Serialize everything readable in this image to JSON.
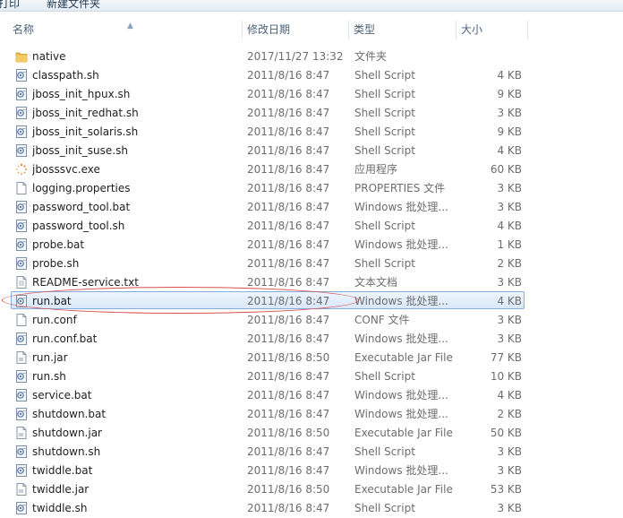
{
  "toolbar": {
    "print_label": "打印",
    "new_folder_label": "新建文件夹"
  },
  "columns": {
    "name": "名称",
    "date": "修改日期",
    "type": "类型",
    "size": "大小"
  },
  "files": [
    {
      "name": "native",
      "date": "2017/11/27 13:32",
      "type": "文件夹",
      "size": "",
      "icon": "folder-icon"
    },
    {
      "name": "classpath.sh",
      "date": "2011/8/16 8:47",
      "type": "Shell Script",
      "size": "4 KB",
      "icon": "script-file-icon"
    },
    {
      "name": "jboss_init_hpux.sh",
      "date": "2011/8/16 8:47",
      "type": "Shell Script",
      "size": "9 KB",
      "icon": "script-file-icon"
    },
    {
      "name": "jboss_init_redhat.sh",
      "date": "2011/8/16 8:47",
      "type": "Shell Script",
      "size": "3 KB",
      "icon": "script-file-icon"
    },
    {
      "name": "jboss_init_solaris.sh",
      "date": "2011/8/16 8:47",
      "type": "Shell Script",
      "size": "9 KB",
      "icon": "script-file-icon"
    },
    {
      "name": "jboss_init_suse.sh",
      "date": "2011/8/16 8:47",
      "type": "Shell Script",
      "size": "4 KB",
      "icon": "script-file-icon"
    },
    {
      "name": "jbosssvc.exe",
      "date": "2011/8/16 8:47",
      "type": "应用程序",
      "size": "60 KB",
      "icon": "exe-icon"
    },
    {
      "name": "logging.properties",
      "date": "2011/8/16 8:47",
      "type": "PROPERTIES 文件",
      "size": "3 KB",
      "icon": "blank-file-icon"
    },
    {
      "name": "password_tool.bat",
      "date": "2011/8/16 8:47",
      "type": "Windows 批处理...",
      "size": "3 KB",
      "icon": "script-file-icon"
    },
    {
      "name": "password_tool.sh",
      "date": "2011/8/16 8:47",
      "type": "Shell Script",
      "size": "4 KB",
      "icon": "script-file-icon"
    },
    {
      "name": "probe.bat",
      "date": "2011/8/16 8:47",
      "type": "Windows 批处理...",
      "size": "1 KB",
      "icon": "script-file-icon"
    },
    {
      "name": "probe.sh",
      "date": "2011/8/16 8:47",
      "type": "Shell Script",
      "size": "2 KB",
      "icon": "script-file-icon"
    },
    {
      "name": "README-service.txt",
      "date": "2011/8/16 8:47",
      "type": "文本文档",
      "size": "3 KB",
      "icon": "text-file-icon"
    },
    {
      "name": "run.bat",
      "date": "2011/8/16 8:47",
      "type": "Windows 批处理...",
      "size": "4 KB",
      "icon": "script-file-icon",
      "selected": true
    },
    {
      "name": "run.conf",
      "date": "2011/8/16 8:47",
      "type": "CONF 文件",
      "size": "3 KB",
      "icon": "blank-file-icon"
    },
    {
      "name": "run.conf.bat",
      "date": "2011/8/16 8:47",
      "type": "Windows 批处理...",
      "size": "3 KB",
      "icon": "script-file-icon"
    },
    {
      "name": "run.jar",
      "date": "2011/8/16 8:50",
      "type": "Executable Jar File",
      "size": "77 KB",
      "icon": "jar-file-icon"
    },
    {
      "name": "run.sh",
      "date": "2011/8/16 8:47",
      "type": "Shell Script",
      "size": "10 KB",
      "icon": "script-file-icon"
    },
    {
      "name": "service.bat",
      "date": "2011/8/16 8:47",
      "type": "Windows 批处理...",
      "size": "4 KB",
      "icon": "script-file-icon"
    },
    {
      "name": "shutdown.bat",
      "date": "2011/8/16 8:47",
      "type": "Windows 批处理...",
      "size": "2 KB",
      "icon": "script-file-icon"
    },
    {
      "name": "shutdown.jar",
      "date": "2011/8/16 8:50",
      "type": "Executable Jar File",
      "size": "50 KB",
      "icon": "jar-file-icon"
    },
    {
      "name": "shutdown.sh",
      "date": "2011/8/16 8:47",
      "type": "Shell Script",
      "size": "3 KB",
      "icon": "script-file-icon"
    },
    {
      "name": "twiddle.bat",
      "date": "2011/8/16 8:47",
      "type": "Windows 批处理...",
      "size": "3 KB",
      "icon": "script-file-icon"
    },
    {
      "name": "twiddle.jar",
      "date": "2011/8/16 8:50",
      "type": "Executable Jar File",
      "size": "53 KB",
      "icon": "jar-file-icon"
    },
    {
      "name": "twiddle.sh",
      "date": "2011/8/16 8:47",
      "type": "Shell Script",
      "size": "3 KB",
      "icon": "script-file-icon"
    }
  ],
  "colors": {
    "selection_border": "#84acdd",
    "annotation_oval": "#d85050",
    "folder": "#e8b84a"
  }
}
